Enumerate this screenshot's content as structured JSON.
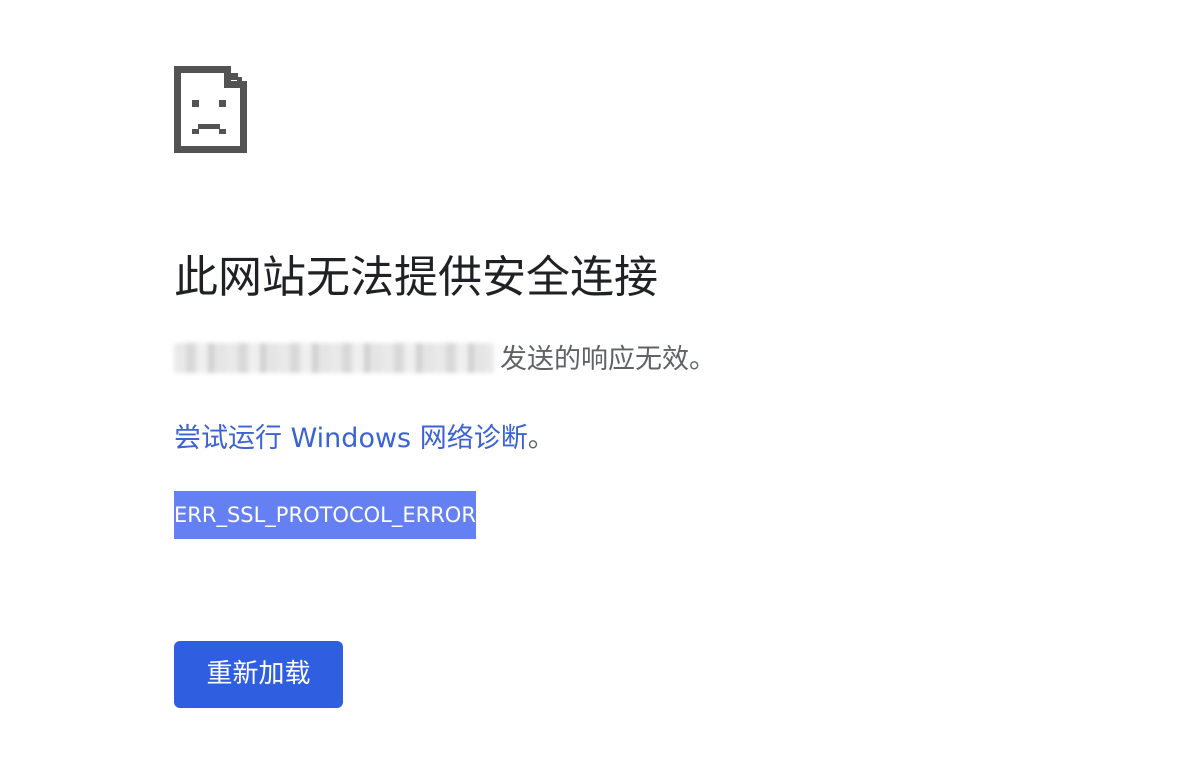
{
  "icon": {
    "name": "sad-page-icon",
    "color": "#535353"
  },
  "title": "此网站无法提供安全连接",
  "message": {
    "host_redacted": true,
    "text": "发送的响应无效。"
  },
  "diagnostics": {
    "link_text": "尝试运行 Windows 网络诊断",
    "suffix": "。"
  },
  "error_code": "ERR_SSL_PROTOCOL_ERROR",
  "reload_button": {
    "label": "重新加载"
  },
  "colors": {
    "link": "#3b63d6",
    "button": "#2f5fe0",
    "selection": "#6480f2",
    "title": "#202124",
    "body_text": "#5f6368"
  }
}
